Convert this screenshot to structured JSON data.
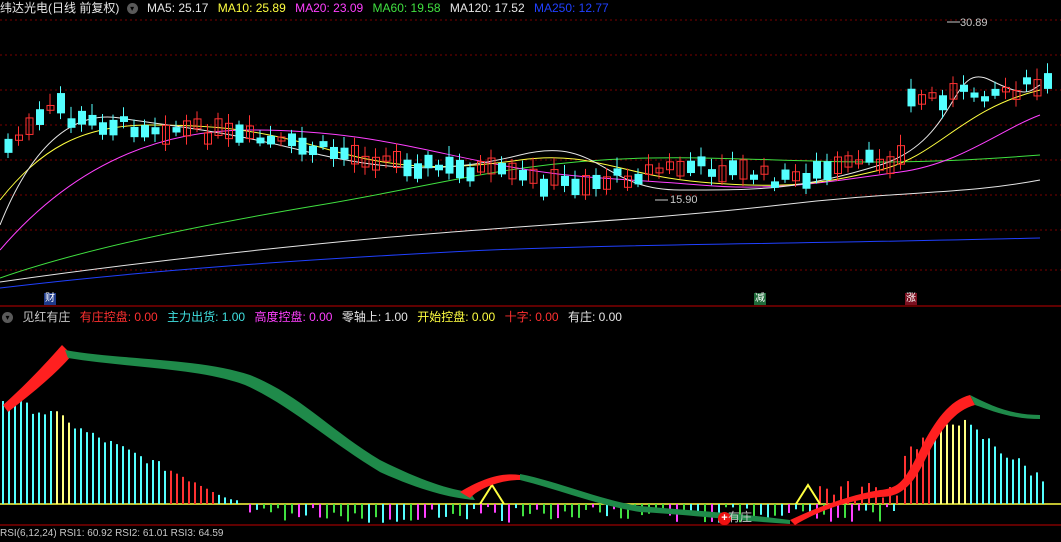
{
  "header": {
    "title": "纬达光电(日线 前复权)",
    "ma_items": [
      {
        "label": "MA5: 25.17",
        "color": "#e6e6e6"
      },
      {
        "label": "MA10: 25.89",
        "color": "#ffff40"
      },
      {
        "label": "MA20: 23.09",
        "color": "#ff40ff"
      },
      {
        "label": "MA60: 19.58",
        "color": "#40e040"
      },
      {
        "label": "MA120: 17.52",
        "color": "#e6e6e6"
      },
      {
        "label": "MA250: 12.77",
        "color": "#2040ff"
      }
    ]
  },
  "price_notes": {
    "high": "30.89",
    "low": "15.90"
  },
  "event_tags": {
    "cai": "财",
    "jian": "减",
    "zhang": "涨"
  },
  "indicator": {
    "name": "见红有庄",
    "items": [
      {
        "label": "有庄控盘: 0.00",
        "color": "#ff3030"
      },
      {
        "label": "主力出货: 1.00",
        "color": "#40e0e0"
      },
      {
        "label": "高度控盘: 0.00",
        "color": "#ff40ff"
      },
      {
        "label": "零轴上: 1.00",
        "color": "#e6e6e6"
      },
      {
        "label": "开始控盘: 0.00",
        "color": "#ffff40"
      },
      {
        "label": "十字: 0.00",
        "color": "#ff3030"
      },
      {
        "label": "有庄: 0.00",
        "color": "#e6e6e6"
      }
    ],
    "marker_label": "有庄"
  },
  "bottom": {
    "text": "RSI(6,12,24)  RSI1: 60.92  RSI2: 61.01  RSI3: 64.59"
  },
  "colors": {
    "up": "#ff3232",
    "down": "#54ffff",
    "grid": "#8b0000",
    "divider": "#b00000"
  }
}
